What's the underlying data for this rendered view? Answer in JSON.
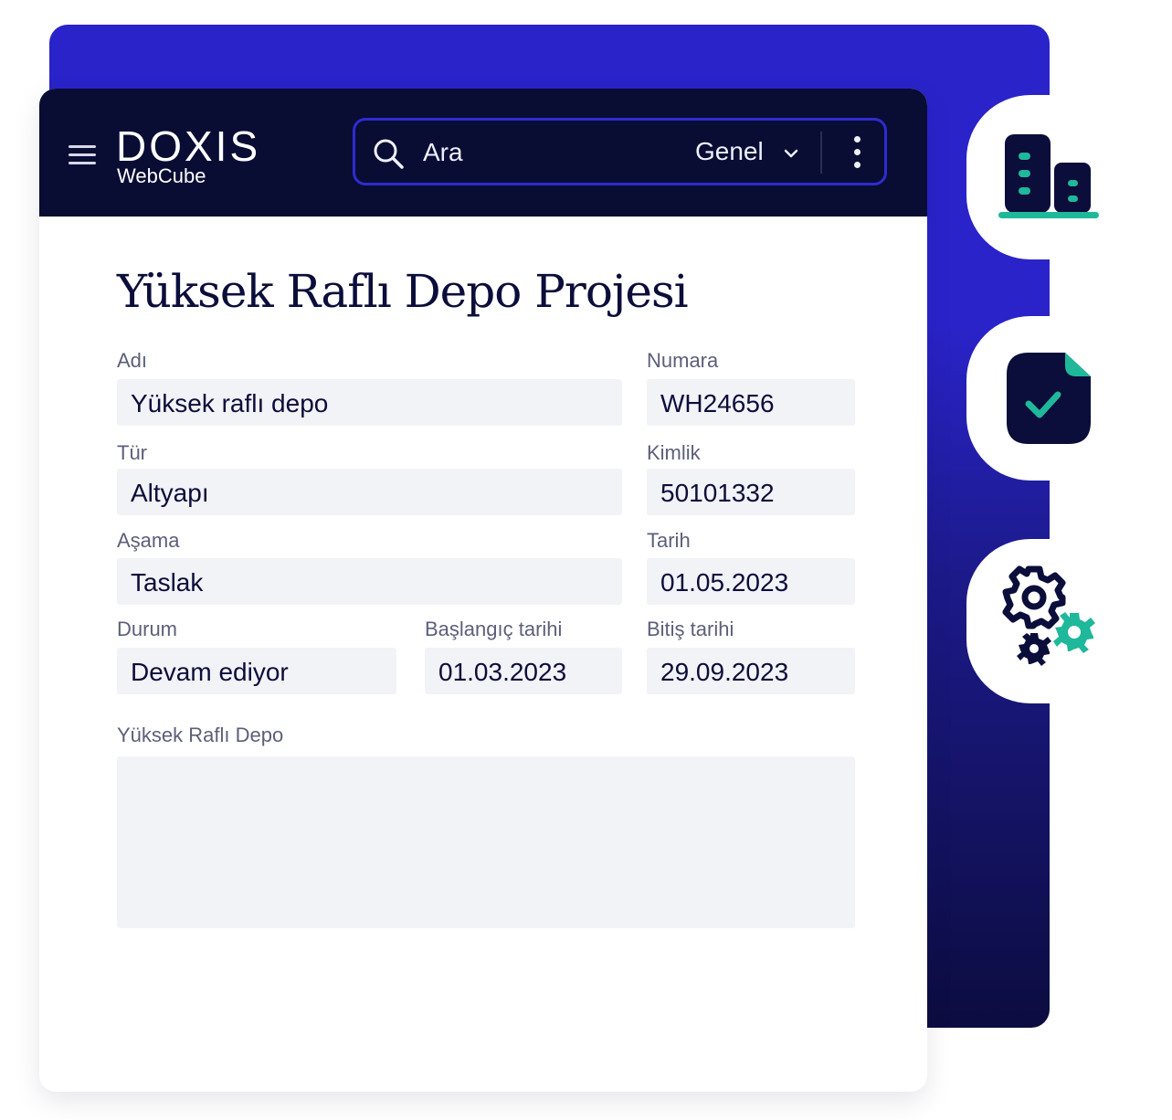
{
  "app": {
    "logo_main": "DOXIS",
    "logo_sub": "WebCube"
  },
  "search": {
    "placeholder": "Ara",
    "scope": "Genel"
  },
  "page": {
    "title": "Yüksek Raflı Depo Projesi"
  },
  "form": {
    "name_label": "Adı",
    "name_value": "Yüksek raflı depo",
    "number_label": "Numara",
    "number_value": "WH24656",
    "type_label": "Tür",
    "type_value": "Altyapı",
    "id_label": "Kimlik",
    "id_value": "50101332",
    "stage_label": "Aşama",
    "stage_value": "Taslak",
    "date_label": "Tarih",
    "date_value": "01.05.2023",
    "status_label": "Durum",
    "status_value": "Devam ediyor",
    "start_label": "Başlangıç tarihi",
    "start_value": "01.03.2023",
    "end_label": "Bitiş tarihi",
    "end_value": "29.09.2023",
    "description_label": "Yüksek Raflı Depo",
    "description_value": ""
  },
  "side_tabs": [
    "buildings-icon",
    "document-check-icon",
    "settings-gears-icon"
  ],
  "colors": {
    "topbar": "#090c33",
    "accent_blue": "#2a23c9",
    "accent_teal": "#1fb89a",
    "field_bg": "#f2f3f7",
    "text_dark": "#0b0d3a"
  }
}
